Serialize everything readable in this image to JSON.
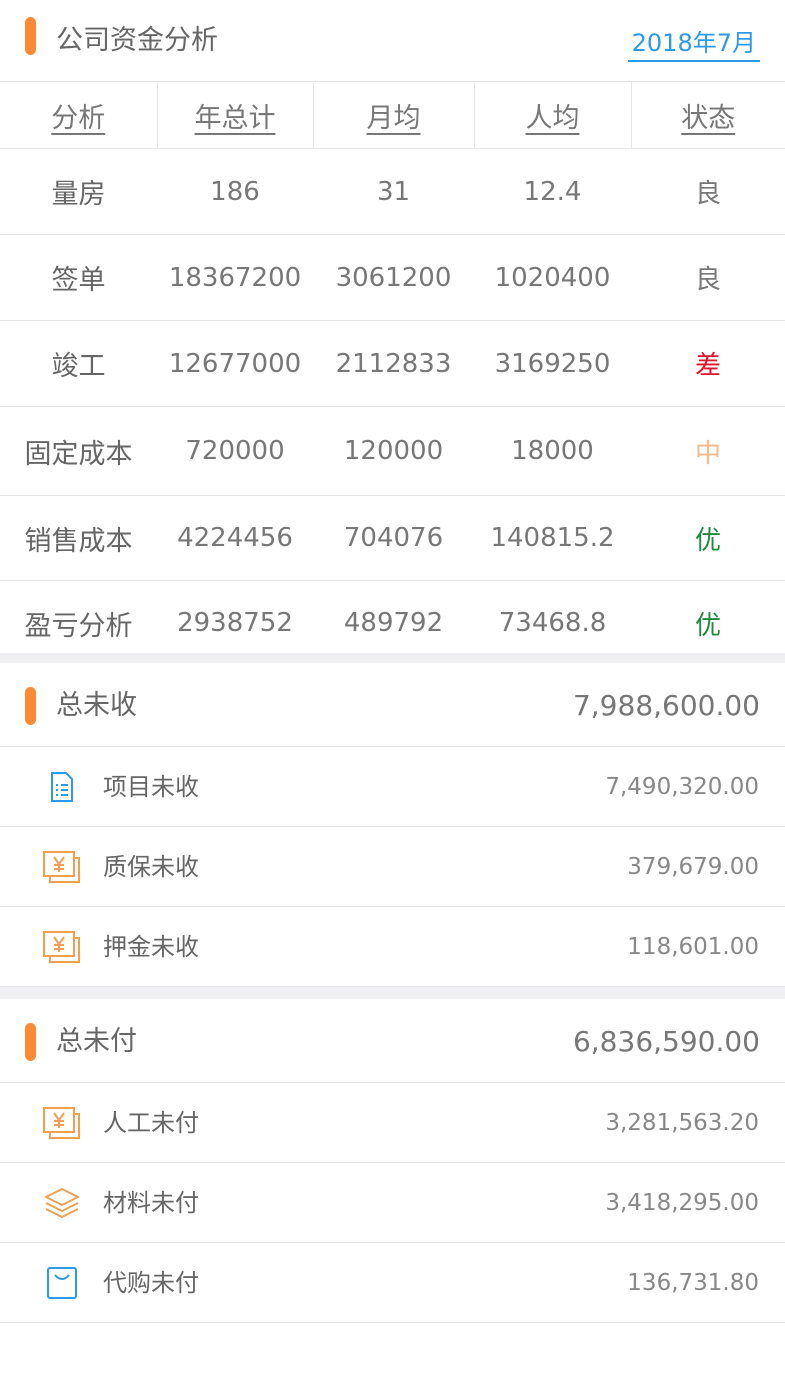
{
  "header": {
    "title": "公司资金分析",
    "date": "2018年7月"
  },
  "analysis": {
    "columns": [
      "分析",
      "年总计",
      "月均",
      "人均",
      "状态"
    ],
    "rows": [
      {
        "name": "量房",
        "total": "186",
        "monthly": "31",
        "per_person": "12.4",
        "status": "良"
      },
      {
        "name": "签单",
        "total": "18367200",
        "monthly": "3061200",
        "per_person": "1020400",
        "status": "良"
      },
      {
        "name": "竣工",
        "total": "12677000",
        "monthly": "2112833",
        "per_person": "3169250",
        "status": "差"
      },
      {
        "name": "固定成本",
        "total": "720000",
        "monthly": "120000",
        "per_person": "18000",
        "status": "中"
      },
      {
        "name": "销售成本",
        "total": "4224456",
        "monthly": "704076",
        "per_person": "140815.2",
        "status": "优"
      },
      {
        "name": "盈亏分析",
        "total": "2938752",
        "monthly": "489792",
        "per_person": "73468.8",
        "status": "优"
      }
    ],
    "status_colors": {
      "良": "#777777",
      "差": "#e0142c",
      "中": "#f5b98a",
      "优": "#1e8a3c"
    }
  },
  "receivable": {
    "title": "总未收",
    "total": "7,988,600.00",
    "items": [
      {
        "label": "项目未收",
        "value": "7,490,320.00",
        "icon": "list-document-icon"
      },
      {
        "label": "质保未收",
        "value": "379,679.00",
        "icon": "yuan-bill-icon"
      },
      {
        "label": "押金未收",
        "value": "118,601.00",
        "icon": "yuan-bill-icon"
      }
    ]
  },
  "payable": {
    "title": "总未付",
    "total": "6,836,590.00",
    "items": [
      {
        "label": "人工未付",
        "value": "3,281,563.20",
        "icon": "yuan-bill-icon"
      },
      {
        "label": "材料未付",
        "value": "3,418,295.00",
        "icon": "layers-icon"
      },
      {
        "label": "代购未付",
        "value": "136,731.80",
        "icon": "shopping-bag-icon"
      }
    ]
  },
  "colors": {
    "accent": "#ff8a33",
    "link": "#2c9ae8",
    "icon_orange": "#f0a050",
    "icon_blue": "#2c9ae8"
  }
}
